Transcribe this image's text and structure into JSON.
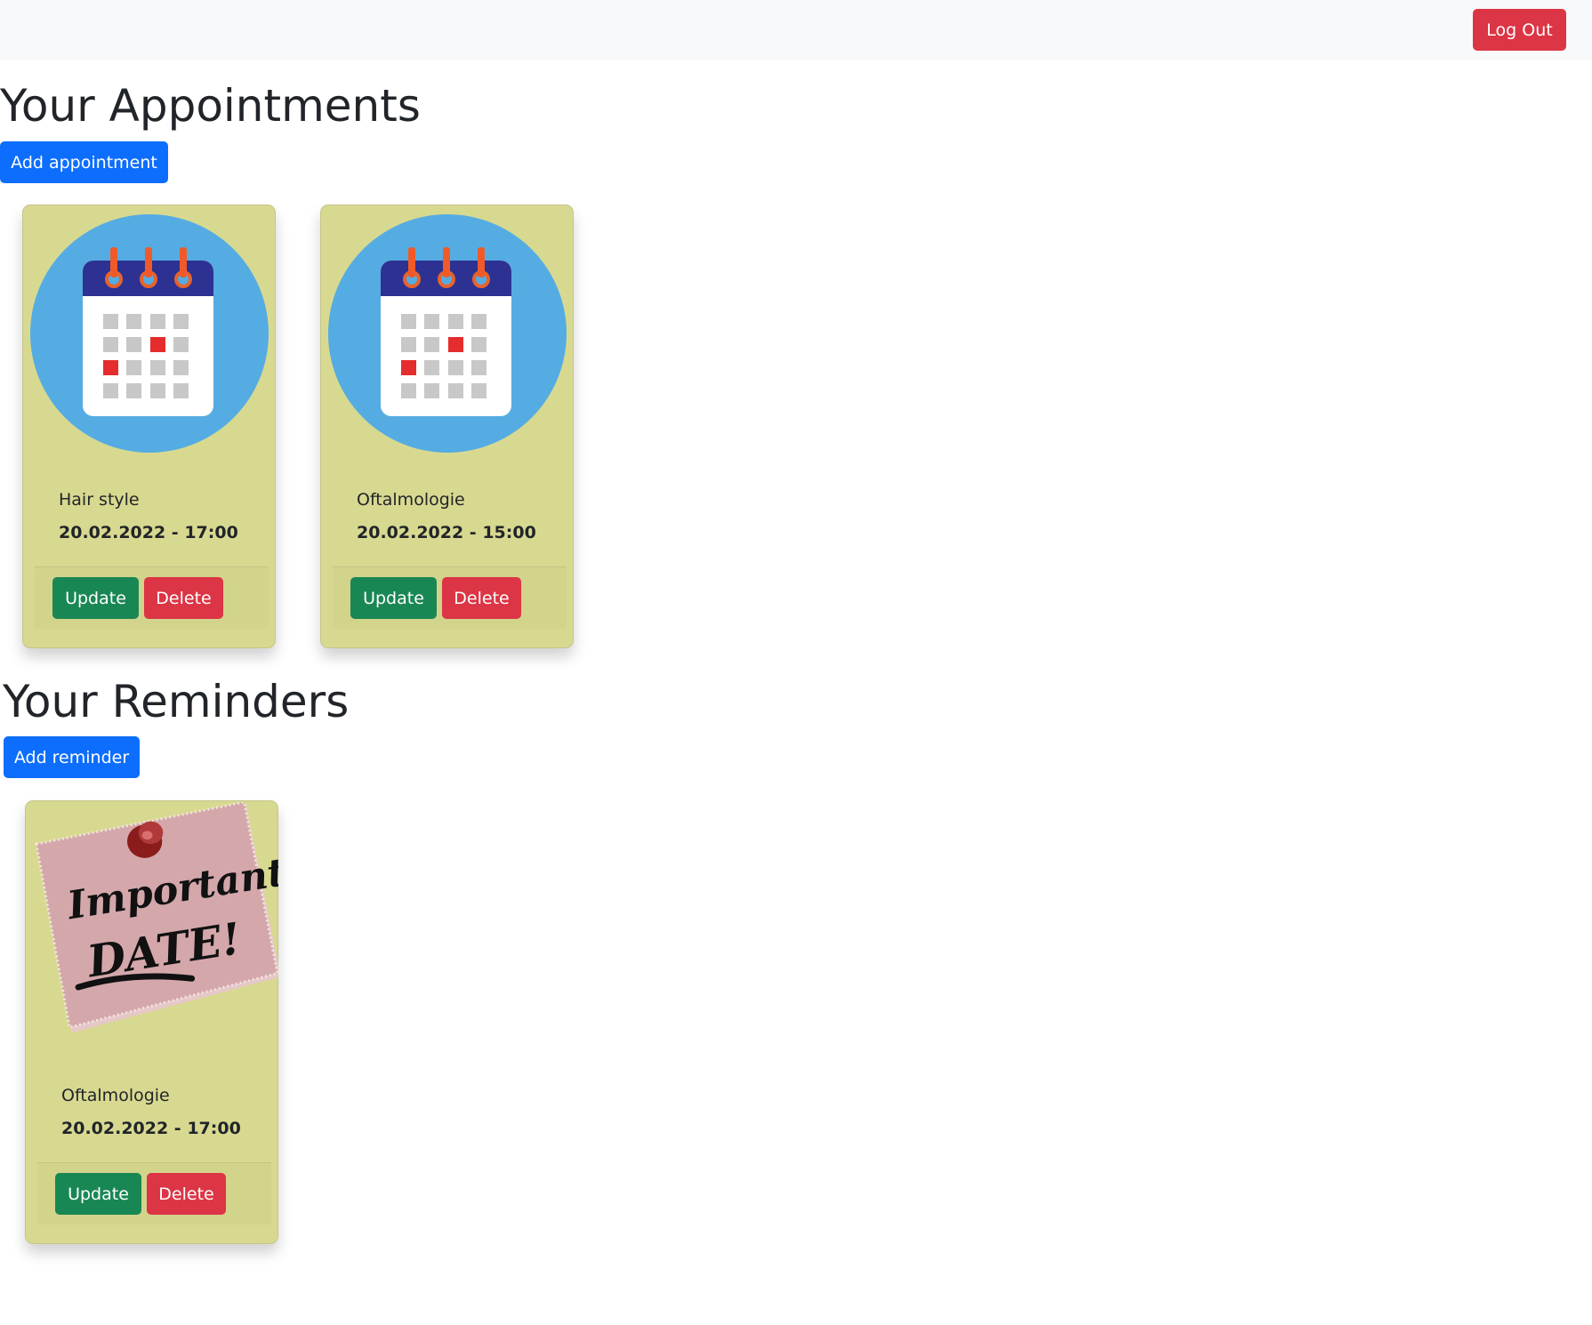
{
  "navbar": {
    "logout_label": "Log Out"
  },
  "appointments": {
    "title": "Your Appointments",
    "add_label": "Add appointment",
    "items": [
      {
        "name": "Hair style",
        "datetime": "20.02.2022 - 17:00",
        "update_label": "Update",
        "delete_label": "Delete",
        "image": "calendar-icon"
      },
      {
        "name": "Oftalmologie",
        "datetime": "20.02.2022 - 15:00",
        "update_label": "Update",
        "delete_label": "Delete",
        "image": "calendar-icon"
      }
    ]
  },
  "reminders": {
    "title": "Your Reminders",
    "add_label": "Add reminder",
    "items": [
      {
        "name": "Oftalmologie",
        "datetime": "20.02.2022 - 17:00",
        "update_label": "Update",
        "delete_label": "Delete",
        "image": "sticky-note-image",
        "note_line1": "Important",
        "note_line2": "DATE!"
      }
    ]
  },
  "colors": {
    "card_bg": "#d8d990",
    "primary": "#0d6efd",
    "success": "#198754",
    "danger": "#dc3545"
  }
}
